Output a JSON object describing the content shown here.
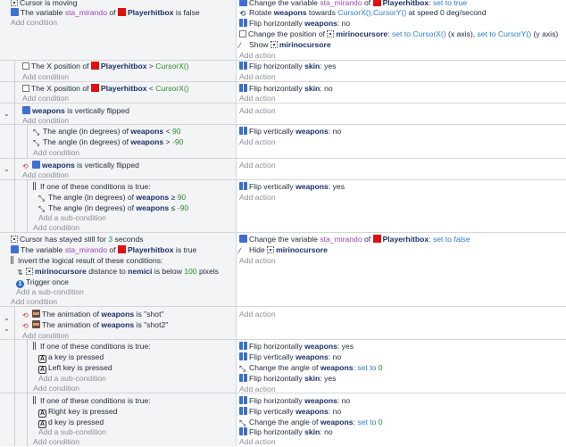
{
  "e1": {
    "c1": "Cursor is moving",
    "c2_pre": "The variable",
    "c2_var": "sta_mirando",
    "c2_of": "of",
    "c2_obj": "Playerhitbox",
    "c2_post": "is false",
    "add_condition": "Add condition",
    "a1_pre": "Change the variable",
    "a1_var": "sta_mirando",
    "a1_of": "of",
    "a1_obj": "Playerhitbox",
    "a1_kw": "set to true",
    "a2_pre": "Rotate",
    "a2_obj": "weapons",
    "a2_mid": "towards",
    "a2_kw": "CursorX();CursorY()",
    "a2_post": "at speed 0 deg/second",
    "a3_pre": "Flip horizontally",
    "a3_obj": "weapons",
    "a3_post": ": no",
    "a4_pre": "Change the position of",
    "a4_obj": "mirinocursore",
    "a4_mid": ":",
    "a4_kw1": "set to CursorX()",
    "a4_mid2": "(x axis),",
    "a4_kw2": "set to CursorY()",
    "a4_post": "(y axis)",
    "a5_pre": "Show",
    "a5_obj": "mirinocursore",
    "add_action": "Add action"
  },
  "e2": {
    "c_pre": "The X position of",
    "c_obj": "Playerhitbox",
    "c_post": ">",
    "c_kw": "CursorX()",
    "add_condition": "Add condition",
    "a_pre": "Flip horizontally",
    "a_obj": "skin",
    "a_post": ": yes",
    "add_action": "Add action"
  },
  "e3": {
    "c_pre": "The X position of",
    "c_obj": "Playerhitbox",
    "c_post": "<",
    "c_kw": "CursorX()",
    "add_condition": "Add condition",
    "a_pre": "Flip horizontally",
    "a_obj": "skin",
    "a_post": ": no",
    "add_action": "Add action"
  },
  "e4": {
    "c_obj": "weapons",
    "c_post": "is vertically flipped",
    "add_condition": "Add condition",
    "add_action": "Add action"
  },
  "e5": {
    "c1_pre": "The angle (in degrees) of",
    "c1_obj": "weapons",
    "c1_op": "<",
    "c1_num": "90",
    "c2_pre": "The angle (in degrees) of",
    "c2_obj": "weapons",
    "c2_op": ">",
    "c2_num": "-90",
    "add_condition": "Add condition",
    "a_pre": "Flip vertically",
    "a_obj": "weapons",
    "a_post": ": no",
    "add_action": "Add action"
  },
  "e6": {
    "c_obj": "weapons",
    "c_post": "is vertically flipped",
    "add_condition": "Add condition",
    "add_action": "Add action"
  },
  "e7": {
    "c_or": "If one of these conditions is true:",
    "c1_pre": "The angle (in degrees) of",
    "c1_obj": "weapons",
    "c1_op": "≥",
    "c1_num": "90",
    "c2_pre": "The angle (in degrees) of",
    "c2_obj": "weapons",
    "c2_op": "≤",
    "c2_num": "-90",
    "add_sub": "Add a sub-condition",
    "add_condition": "Add condition",
    "a_pre": "Flip vertically",
    "a_obj": "weapons",
    "a_post": ": yes",
    "add_action": "Add action"
  },
  "e8": {
    "c1_pre": "Cursor has stayed still for",
    "c1_num": "3",
    "c1_post": "seconds",
    "c2_pre": "The variable",
    "c2_var": "sta_mirando",
    "c2_of": "of",
    "c2_obj": "Playerhitbox",
    "c2_post": "is true",
    "c3": "Invert the logical result of these conditions:",
    "c4_obj": "mirinocursore",
    "c4_mid": "distance to",
    "c4_obj2": "nemici",
    "c4_post": "is below",
    "c4_num": "100",
    "c4_post2": "pixels",
    "c5": "Trigger once",
    "add_sub": "Add a sub-condition",
    "add_condition": "Add condition",
    "a1_pre": "Change the variable",
    "a1_var": "sta_mirando",
    "a1_of": "of",
    "a1_obj": "Playerhitbox",
    "a1_kw": "set to false",
    "a2_pre": "Hide",
    "a2_obj": "mirinocursore",
    "add_action": "Add action"
  },
  "e9": {
    "c1_pre": "The animation of",
    "c1_obj": "weapons",
    "c1_post": "is \"shot\"",
    "c2_pre": "The animation of",
    "c2_obj": "weapons",
    "c2_post": "is \"shot2\"",
    "add_condition": "Add condition",
    "add_action": "Add action"
  },
  "e10": {
    "c_or": "If one of these conditions is true:",
    "c1_key": "a",
    "c1_post": "key is pressed",
    "c2_key": "Left",
    "c2_post": "key is pressed",
    "add_sub": "Add a sub-condition",
    "add_condition": "Add condition",
    "a1_pre": "Flip horizontally",
    "a1_obj": "weapons",
    "a1_post": ": yes",
    "a2_pre": "Flip vertically",
    "a2_obj": "weapons",
    "a2_post": ": no",
    "a3_pre": "Change the angle of",
    "a3_obj": "weapons",
    "a3_mid": ":",
    "a3_kw": "set to",
    "a3_num": "0",
    "a4_pre": "Flip horizontally",
    "a4_obj": "skin",
    "a4_post": ": yes",
    "add_action": "Add action"
  },
  "e11": {
    "c_or": "If one of these conditions is true:",
    "c1_key": "Right",
    "c1_post": "key is pressed",
    "c2_key": "d",
    "c2_post": "key is pressed",
    "add_sub": "Add a sub-condition",
    "add_condition": "Add condition",
    "a1_pre": "Flip horizontally",
    "a1_obj": "weapons",
    "a1_post": ": no",
    "a2_pre": "Flip vertically",
    "a2_obj": "weapons",
    "a2_post": ": no",
    "a3_pre": "Change the angle of",
    "a3_obj": "weapons",
    "a3_mid": ":",
    "a3_kw": "set to",
    "a3_num": "0",
    "a4_pre": "Flip horizontally",
    "a4_obj": "skin",
    "a4_post": ": no",
    "add_action": "Add action"
  }
}
